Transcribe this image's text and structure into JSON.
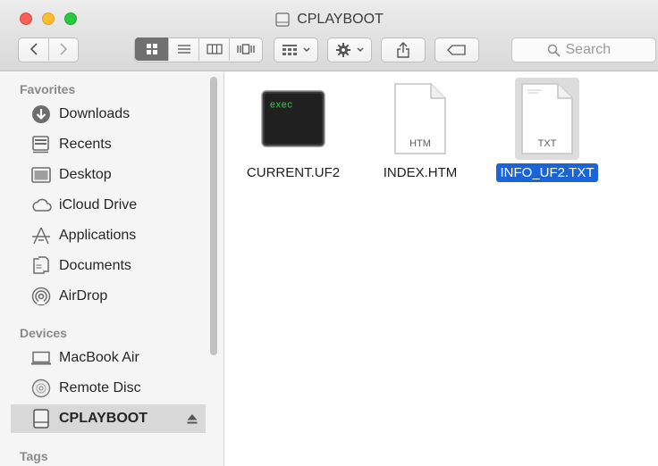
{
  "window": {
    "title": "CPLAYBOOT"
  },
  "toolbar": {
    "back_icon": "chevron-left-icon",
    "forward_icon": "chevron-right-icon",
    "view_modes": [
      "icon-view",
      "list-view",
      "column-view",
      "cover-flow-view"
    ],
    "active_view": "icon-view",
    "search_placeholder": "Search"
  },
  "sidebar": {
    "favorites_title": "Favorites",
    "favorites": [
      {
        "label": "Downloads",
        "icon": "downloads-icon"
      },
      {
        "label": "Recents",
        "icon": "recents-icon"
      },
      {
        "label": "Desktop",
        "icon": "desktop-icon"
      },
      {
        "label": "iCloud Drive",
        "icon": "cloud-icon"
      },
      {
        "label": "Applications",
        "icon": "applications-icon"
      },
      {
        "label": "Documents",
        "icon": "documents-icon"
      },
      {
        "label": "AirDrop",
        "icon": "airdrop-icon"
      }
    ],
    "devices_title": "Devices",
    "devices": [
      {
        "label": "MacBook Air",
        "icon": "laptop-icon"
      },
      {
        "label": "Remote Disc",
        "icon": "disc-icon"
      },
      {
        "label": "CPLAYBOOT",
        "icon": "drive-icon",
        "selected": true
      }
    ],
    "tags_title": "Tags"
  },
  "files": [
    {
      "name": "CURRENT.UF2",
      "kind": "exec",
      "badge": "exec"
    },
    {
      "name": "INDEX.HTM",
      "kind": "document",
      "ext": "HTM"
    },
    {
      "name": "INFO_UF2.TXT",
      "kind": "document",
      "ext": "TXT",
      "selected": true
    }
  ],
  "colors": {
    "selection": "#1b64d7",
    "accent_close": "#fc5f57",
    "accent_min": "#fdbc2e",
    "accent_max": "#28c840"
  }
}
